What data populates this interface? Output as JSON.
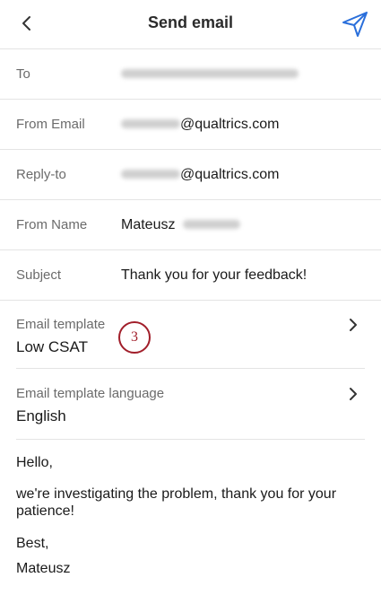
{
  "header": {
    "title": "Send email",
    "back_icon": "chevron-left-icon",
    "send_icon": "paper-plane-icon",
    "accent": "#2a6fdb"
  },
  "fields": {
    "to": {
      "label": "To"
    },
    "from_email": {
      "label": "From Email",
      "suffix": "@qualtrics.com"
    },
    "reply_to": {
      "label": "Reply-to",
      "suffix": "@qualtrics.com"
    },
    "from_name": {
      "label": "From Name",
      "value": "Mateusz"
    },
    "subject": {
      "label": "Subject",
      "value": "Thank you for your feedback!"
    }
  },
  "template": {
    "label": "Email template",
    "value": "Low CSAT",
    "step_badge": "3"
  },
  "language": {
    "label": "Email template language",
    "value": "English"
  },
  "message": {
    "greeting": "Hello,",
    "body": "we're investigating the problem, thank you for your patience!",
    "signoff": "Best,",
    "signature": "Mateusz"
  },
  "colors": {
    "badge": "#a11e2a",
    "label_gray": "#6b6b6b",
    "divider": "#e4e4e4"
  }
}
